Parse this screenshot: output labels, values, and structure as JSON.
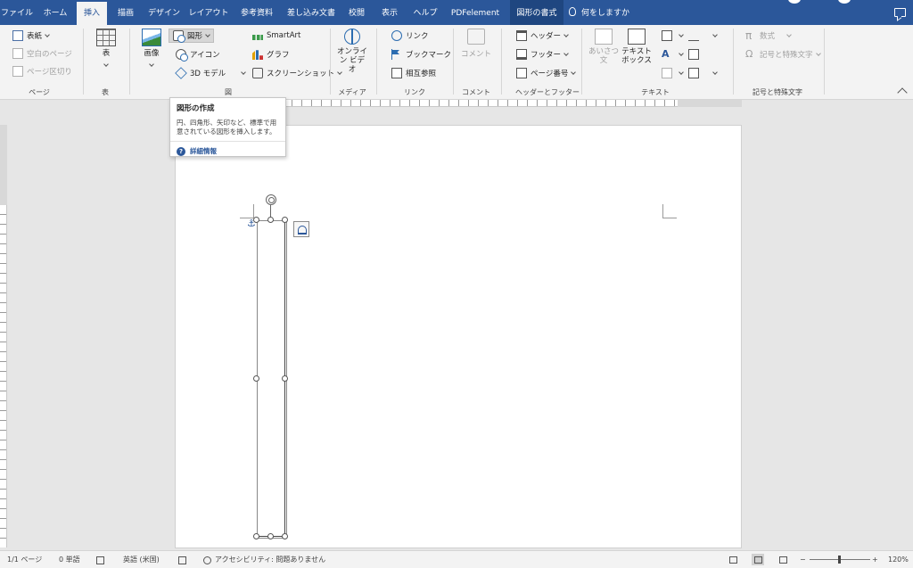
{
  "tabs": [
    {
      "label": "ファイル"
    },
    {
      "label": "ホーム"
    },
    {
      "label": "挿入"
    },
    {
      "label": "描画"
    },
    {
      "label": "デザイン"
    },
    {
      "label": "レイアウト"
    },
    {
      "label": "参考資料"
    },
    {
      "label": "差し込み文書"
    },
    {
      "label": "校閲"
    },
    {
      "label": "表示"
    },
    {
      "label": "ヘルプ"
    },
    {
      "label": "PDFelement"
    },
    {
      "label": "図形の書式"
    },
    {
      "label": "何をしますか"
    }
  ],
  "ribbon": {
    "pages": {
      "cover": "表紙",
      "blank": "空白のページ",
      "break": "ページ区切り",
      "label": "ページ"
    },
    "tables": {
      "table": "表",
      "label": "表"
    },
    "illustrations": {
      "picture": "画像",
      "shapes": "図形",
      "icons": "アイコン",
      "models3d": "3D モデル",
      "smartart": "SmartArt",
      "chart": "グラフ",
      "screenshot": "スクリーンショット",
      "label": "図"
    },
    "media": {
      "online_video_line1": "オンライ",
      "online_video_line2": "ン ビデオ",
      "label": "メディア"
    },
    "links": {
      "link": "リンク",
      "bookmark": "ブックマーク",
      "cross_ref": "相互参照",
      "label": "リンク"
    },
    "comments": {
      "comment": "コメント",
      "label": "コメント"
    },
    "header_footer": {
      "header": "ヘッダー",
      "footer": "フッター",
      "page_number": "ページ番号",
      "label": "ヘッダーとフッター"
    },
    "text": {
      "aisatsu_line1": "あいさつ",
      "aisatsu_line2": "文",
      "textbox_line1": "テキスト",
      "textbox_line2": "ボックス",
      "label": "テキスト"
    },
    "symbols": {
      "equation": "数式",
      "symbol": "記号と特殊文字",
      "label": "記号と特殊文字"
    }
  },
  "tooltip": {
    "title": "図形の作成",
    "desc": "円、四角形、矢印など、標準で用意されている図形を挿入します。",
    "more": "詳細情報"
  },
  "status": {
    "page": "1/1 ページ",
    "words": "0 単語",
    "language": "英語 (米国)",
    "accessibility": "アクセシビリティ: 問題ありません",
    "zoom_minus": "−",
    "zoom_plus": "+",
    "zoom": "120%"
  },
  "colors": {
    "accent": "#2b579a",
    "ribbon_bg": "#f3f3f3",
    "canvas_bg": "#e6e6e6"
  }
}
